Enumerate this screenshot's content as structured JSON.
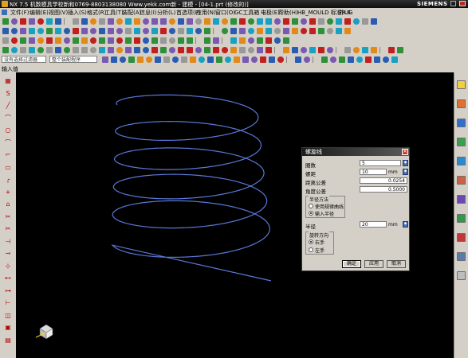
{
  "window": {
    "title": "NX 7.5 机数模具学校新和0769-8803138080 Www.yekk.com新 - 建模 - [04-1.prt (修改的)]",
    "brand": "SIEMENS"
  },
  "menu": [
    "文件(F)",
    "编辑(E)",
    "视图(V)",
    "插入(S)",
    "格式(R)",
    "工具(T)",
    "装配(A)",
    "信息(I)",
    "分析(L)",
    "首选项(P)",
    "应用(N)",
    "窗口(O)",
    "GC工具箱",
    "电极(E)",
    "帮助(H)",
    "HB_MOULD 标准8.6",
    "外UG"
  ],
  "toolbar": {
    "filter_label": "没有选择过滤器",
    "scope_label": "整个装配程序",
    "colors": {
      "icon_blue": "#2a5db0",
      "icon_orange": "#e08a1a",
      "icon_red": "#c02020",
      "icon_green": "#2f8f3a",
      "icon_cyan": "#1aa0c0"
    }
  },
  "cue_line": {
    "label": "输入值"
  },
  "canvas": {
    "background": "#000000",
    "helix_color": "#5a78d8"
  },
  "dialog": {
    "title": "螺旋线",
    "fields": [
      {
        "label": "圈数",
        "value": "5",
        "unit": ""
      },
      {
        "label": "螺距",
        "value": "10",
        "unit": "mm"
      },
      {
        "label": "距离公差",
        "value": "0.0254",
        "unit": ""
      },
      {
        "label": "角度公差",
        "value": "0.5000",
        "unit": ""
      }
    ],
    "radius_group": {
      "title": "半径方法",
      "options": [
        {
          "label": "使用规律曲线",
          "selected": false
        },
        {
          "label": "输入半径",
          "selected": true
        }
      ]
    },
    "radius": {
      "label": "半径",
      "value": "20",
      "unit": "mm"
    },
    "direction_group": {
      "title": "旋转方向",
      "options": [
        {
          "label": "右手",
          "selected": true
        },
        {
          "label": "左手",
          "selected": false
        }
      ]
    },
    "buttons": {
      "ok": "确定",
      "apply": "应用",
      "cancel": "取消"
    }
  }
}
